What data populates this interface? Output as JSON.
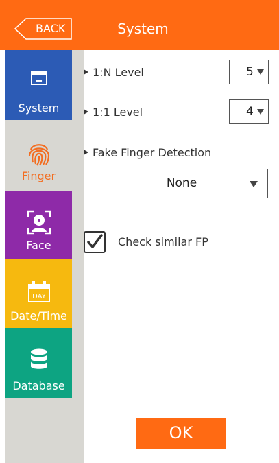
{
  "header": {
    "back_label": "BACK",
    "title": "System"
  },
  "sidebar": {
    "items": [
      {
        "label": "System",
        "icon": "window-icon",
        "color": "#2c5bb5"
      },
      {
        "label": "Finger",
        "icon": "fingerprint-icon",
        "color": "#d8d7d2",
        "text_color": "#f36d21"
      },
      {
        "label": "Face",
        "icon": "face-scan-icon",
        "color": "#8e2aa8"
      },
      {
        "label": "Date/Time",
        "icon": "calendar-day-icon",
        "color": "#f6b90f",
        "icon_text": "DAY"
      },
      {
        "label": "Database",
        "icon": "database-icon",
        "color": "#0da482"
      }
    ]
  },
  "settings": {
    "level_1n": {
      "label": "1:N Level",
      "value": "5"
    },
    "level_11": {
      "label": "1:1 Level",
      "value": "4"
    },
    "fake_finger": {
      "label": "Fake Finger Detection",
      "value": "None"
    },
    "check_similar": {
      "label": "Check similar FP",
      "checked": true
    }
  },
  "footer": {
    "ok_label": "OK"
  },
  "colors": {
    "accent": "#ff6a13",
    "sidebar_bg": "#d8d7d2"
  }
}
